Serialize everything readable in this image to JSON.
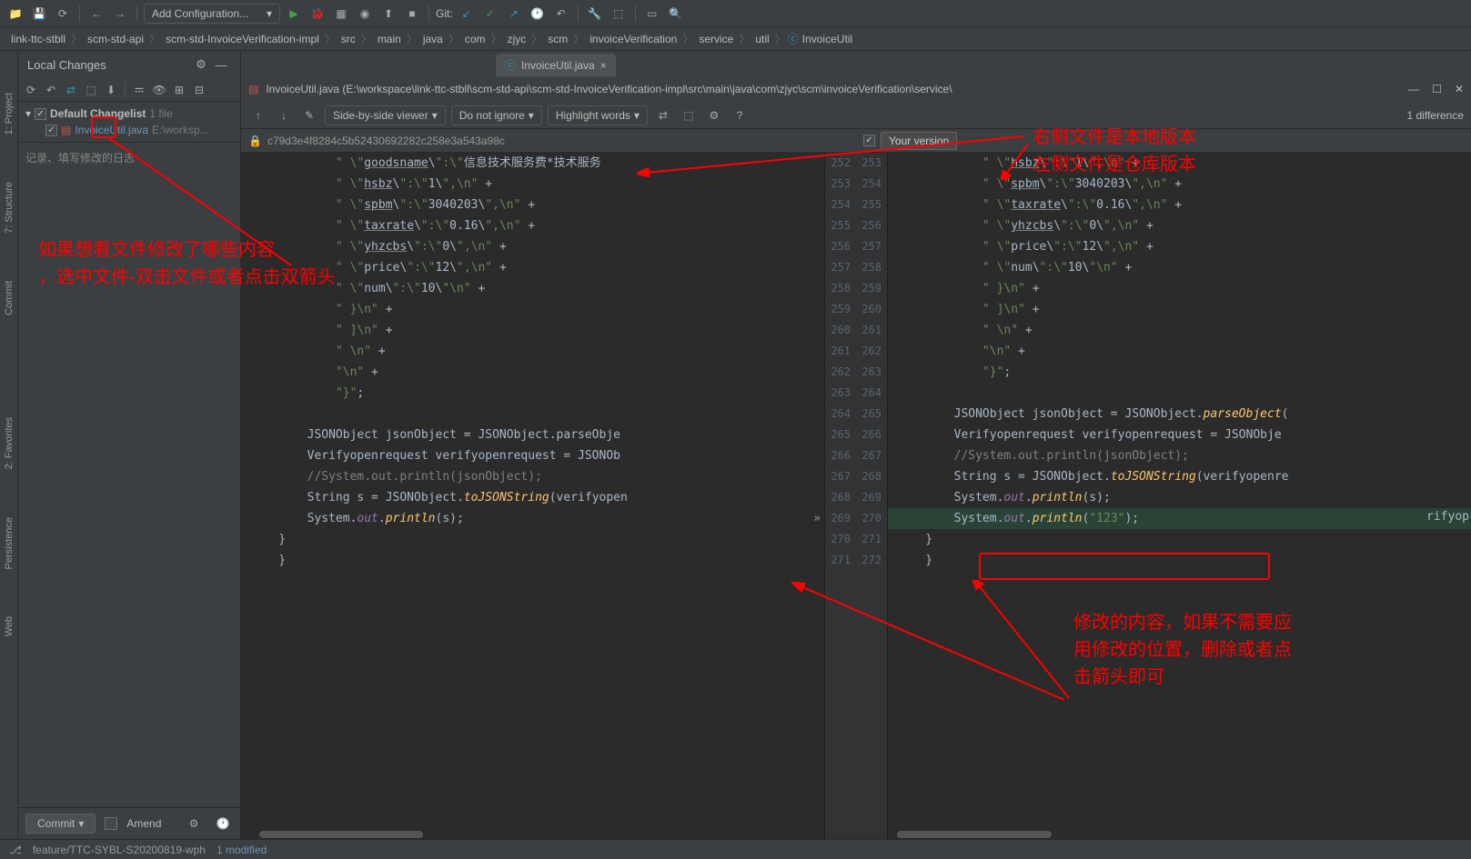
{
  "toolbar": {
    "run_config": "Add Configuration...",
    "git_label": "Git:"
  },
  "breadcrumb": [
    "link-ttc-stbll",
    "scm-std-api",
    "scm-std-InvoiceVerification-impl",
    "src",
    "main",
    "java",
    "com",
    "zjyc",
    "scm",
    "invoiceVerification",
    "service",
    "util",
    "InvoiceUtil"
  ],
  "side_tabs": {
    "project": "1: Project",
    "structure": "7: Structure",
    "commit": "Commit",
    "favorites": "2: Favorites",
    "persistence": "Persistence",
    "web": "Web"
  },
  "commit_panel": {
    "title": "Local Changes",
    "changelist": "Default Changelist",
    "changelist_count": "1 file",
    "file": "InvoiceUtil.java",
    "file_path": "E:\\worksp...",
    "msg_placeholder": "记录、填写修改的日志",
    "commit_btn": "Commit",
    "amend": "Amend"
  },
  "editor": {
    "tab": "InvoiceUtil.java"
  },
  "diff": {
    "title": "InvoiceUtil.java (E:\\workspace\\link-ttc-stbll\\scm-std-api\\scm-std-InvoiceVerification-impl\\src\\main\\java\\com\\zjyc\\scm\\invoiceVerification\\service\\",
    "viewer": "Side-by-side viewer",
    "ignore": "Do not ignore",
    "highlight": "Highlight words",
    "diff_count": "1 difference",
    "left_rev": "c79d3e4f8284c5b52430692282c258e3a543a98c",
    "your_version": "Your version",
    "left_lines": [
      {
        "n": 252,
        "t": "\" \\\"goodsname\\\":\\\"信息技术服务费*技术服务"
      },
      {
        "n": 253,
        "t": "\" \\\"hsbz\\\":\\\"1\\\",\\n\" +"
      },
      {
        "n": 254,
        "t": "\" \\\"spbm\\\":\\\"3040203\\\",\\n\" +"
      },
      {
        "n": 255,
        "t": "\" \\\"taxrate\\\":\\\"0.16\\\",\\n\" +"
      },
      {
        "n": 256,
        "t": "\" \\\"yhzcbs\\\":\\\"0\\\",\\n\" +"
      },
      {
        "n": 257,
        "t": "\" \\\"price\\\":\\\"12\\\",\\n\" +"
      },
      {
        "n": 258,
        "t": "\" \\\"num\\\":\\\"10\\\"\\n\" +"
      },
      {
        "n": 259,
        "t": "\" }\\n\" +"
      },
      {
        "n": 260,
        "t": "\" ]\\n\" +"
      },
      {
        "n": 261,
        "t": "\" \\n\" +"
      },
      {
        "n": 262,
        "t": "\"\\n\" +"
      },
      {
        "n": 263,
        "t": "\"}\";"
      },
      {
        "n": 264,
        "t": ""
      },
      {
        "n": 265,
        "t": "JSONObject jsonObject = JSONObject.parseObje"
      },
      {
        "n": 266,
        "t": "Verifyopenrequest verifyopenrequest = JSONOb"
      },
      {
        "n": 267,
        "t": "//System.out.println(jsonObject);"
      },
      {
        "n": 268,
        "t": "String s = JSONObject.toJSONString(verifyopen"
      },
      {
        "n": 269,
        "t": "System.out.println(s);"
      },
      {
        "n": 270,
        "t": "}"
      },
      {
        "n": 271,
        "t": "}"
      }
    ],
    "right_lines": [
      {
        "n": 253,
        "t": "\" \\\"hsbz\\\":\\\"1\\\",\\n\" +"
      },
      {
        "n": 254,
        "t": "\" \\\"spbm\\\":\\\"3040203\\\",\\n\" +"
      },
      {
        "n": 255,
        "t": "\" \\\"taxrate\\\":\\\"0.16\\\",\\n\" +"
      },
      {
        "n": 256,
        "t": "\" \\\"yhzcbs\\\":\\\"0\\\",\\n\" +"
      },
      {
        "n": 257,
        "t": "\" \\\"price\\\":\\\"12\\\",\\n\" +"
      },
      {
        "n": 258,
        "t": "\" \\\"num\\\":\\\"10\\\"\\n\" +"
      },
      {
        "n": 259,
        "t": "\" }\\n\" +"
      },
      {
        "n": 260,
        "t": "\" ]\\n\" +"
      },
      {
        "n": 261,
        "t": "\" \\n\" +"
      },
      {
        "n": 262,
        "t": "\"\\n\" +"
      },
      {
        "n": 263,
        "t": "\"}\";"
      },
      {
        "n": 264,
        "t": ""
      },
      {
        "n": 265,
        "t": "JSONObject jsonObject = JSONObject.parseObject("
      },
      {
        "n": 266,
        "t": "Verifyopenrequest verifyopenrequest = JSONObje"
      },
      {
        "n": 267,
        "t": "//System.out.println(jsonObject);"
      },
      {
        "n": 268,
        "t": "String s = JSONObject.toJSONString(verifyopenre"
      },
      {
        "n": 269,
        "t": "System.out.println(s);"
      },
      {
        "n": 270,
        "t": "System.out.println(\"123\");",
        "added": true
      },
      {
        "n": 271,
        "t": "}"
      },
      {
        "n": 272,
        "t": "}"
      },
      {
        "n": "",
        "t": ""
      }
    ]
  },
  "statusbar": {
    "branch": "feature/TTC-SYBL-S20200819-wph",
    "modified": "1 modified"
  },
  "annotations": {
    "a1": "如果想看文件修改了哪些内容\n，选中文件-双击文件或者点击双箭头",
    "a2": "右侧文件是本地版本\n左侧文件是仓库版本",
    "a3": "修改的内容，如果不需要应\n用修改的位置，删除或者点\n击箭头即可"
  }
}
